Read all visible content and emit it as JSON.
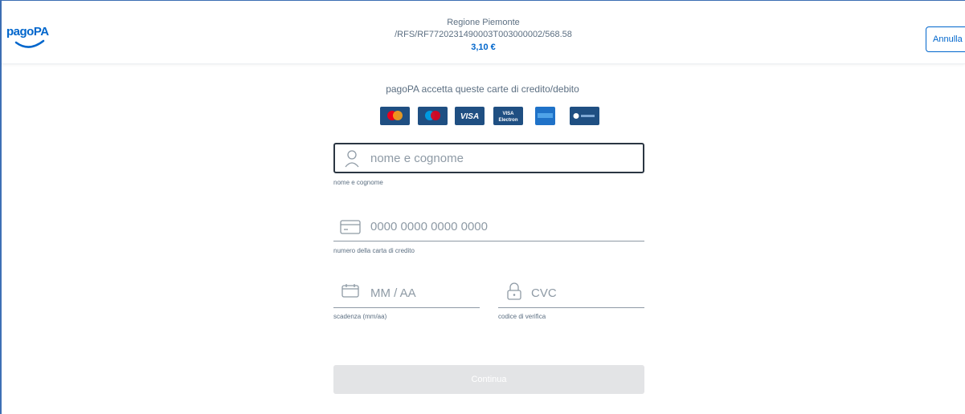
{
  "header": {
    "logo_text": "pagoPA",
    "creditor": "Regione Piemonte",
    "reference": "/RFS/RF7720231490003T003000002/568.58",
    "amount": "3,10 €",
    "cancel_label": "Annulla"
  },
  "accepted": {
    "text": "pagoPA accetta queste carte di credito/debito",
    "cards": [
      "mastercard-icon",
      "maestro-icon",
      "visa-icon",
      "visa-electron-icon",
      "amex-icon",
      "diners-icon"
    ],
    "cards_text": {
      "visa": "VISA",
      "visa_electron_top": "VISA",
      "visa_electron_bottom": "Electron"
    }
  },
  "form": {
    "name": {
      "placeholder": "nome e cognome",
      "helper": "nome e cognome"
    },
    "card_number": {
      "placeholder": "0000 0000 0000 0000",
      "helper": "numero della carta di credito"
    },
    "expiry": {
      "placeholder": "MM / AA",
      "helper": "scadenza (mm/aa)"
    },
    "cvc": {
      "placeholder": "CVC",
      "helper": "codice di verifica"
    },
    "continue_label": "Continua"
  },
  "colors": {
    "accent": "#0066cc",
    "text": "#5c6f82",
    "card_bg": "#1f4f82",
    "disabled_button": "#e3e4e6"
  }
}
